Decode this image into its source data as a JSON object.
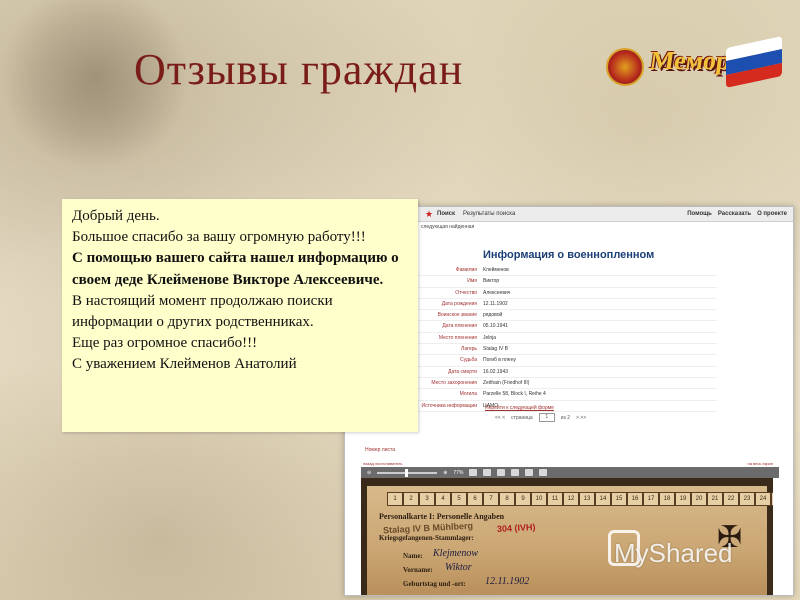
{
  "slide": {
    "title": "Отзывы граждан"
  },
  "logo": {
    "text": "Мемориал",
    "flag_colors": [
      "#ffffff",
      "#1d4fb0",
      "#d52b1e"
    ]
  },
  "screenshot": {
    "topbar": {
      "search": "Поиск",
      "results": "Результаты поиска",
      "links": [
        "Помощь",
        "Рассказать",
        "О проекте"
      ]
    },
    "subnav": "следующая найденная",
    "heading": "Информация о военнопленном",
    "rows": [
      {
        "k": "Фамилия",
        "v": "Клейменов"
      },
      {
        "k": "Имя",
        "v": "Виктор"
      },
      {
        "k": "Отчество",
        "v": "Алексеевич"
      },
      {
        "k": "Дата рождения",
        "v": "12.11.1902"
      },
      {
        "k": "Воинское звание",
        "v": "рядовой"
      },
      {
        "k": "Дата пленения",
        "v": "05.10.1941"
      },
      {
        "k": "Место пленения",
        "v": "Jelnja"
      },
      {
        "k": "Лагерь",
        "v": "Stalag IV B"
      },
      {
        "k": "Судьба",
        "v": "Погиб в плену"
      },
      {
        "k": "Дата смерти",
        "v": "16.02.1943"
      },
      {
        "k": "Место захоронения",
        "v": "Zeithain (Friedhof III)"
      },
      {
        "k": "Могила",
        "v": "Parzelle 58, Block I, Reihe 4"
      },
      {
        "k": "Источника информации",
        "v": "ЦАМО"
      }
    ],
    "next_link": "Перейти к следующей форме",
    "pager": {
      "label": "страница",
      "current": "1",
      "of": "из 2"
    },
    "page_number": "Номер листа",
    "toolbar_left": "назад листоливатель",
    "toolbar_right": "на весь экран",
    "zoom": "77%",
    "doc": {
      "numbers": [
        "1",
        "2",
        "3",
        "4",
        "5",
        "6",
        "7",
        "8",
        "9",
        "10",
        "11",
        "12",
        "13",
        "14",
        "15",
        "16",
        "17",
        "18",
        "19",
        "20",
        "21",
        "22",
        "23",
        "24",
        "25"
      ],
      "header1": "Personalkarte I: Personelle Angaben",
      "header2": "Kriegsgefangenen-Stammlager:",
      "stamp": "Stalag IV B Mühlberg",
      "stamp_num": "304 (IVH)",
      "name_label": "Name:",
      "name_value": "Klejmenow",
      "first_label": "Vorname:",
      "first_value": "Wiktor",
      "birth_label": "Geburtstag und -ort:",
      "birth_value": "12.11.1902"
    }
  },
  "letter": {
    "lines": [
      "Добрый день.",
      "Большое спасибо  за вашу огромную работу!!!",
      "С помощью вашего сайта нашел информацию о своем деде Клейменове Викторе Алексеевиче.",
      "В настоящий момент продолжаю поиски информации о других  родственниках.",
      "Еще раз огромное спасибо!!!",
      "С уважением Клейменов Анатолий"
    ]
  },
  "watermark": "MyShared"
}
